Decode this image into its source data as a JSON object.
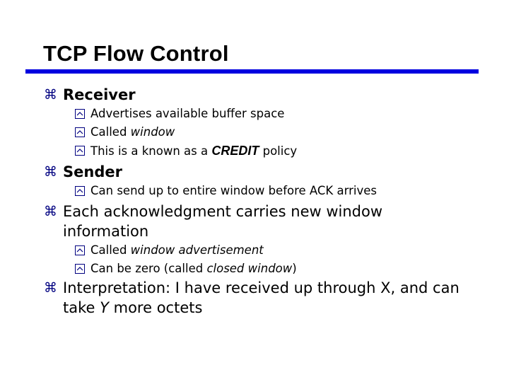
{
  "slide": {
    "title": "TCP Flow Control",
    "bullets": [
      {
        "text": "Receiver",
        "sub": [
          {
            "text": "Advertises available buffer space"
          },
          {
            "pre": "Called ",
            "em": "window"
          },
          {
            "pre": "This is a known as a ",
            "em": "CREDIT",
            "post": " policy"
          }
        ]
      },
      {
        "text": "Sender",
        "sub": [
          {
            "text": "Can send up to entire window before ACK arrives"
          }
        ]
      },
      {
        "line1": "Each acknowledgment carries new window",
        "line2": "information",
        "sub": [
          {
            "pre": "Called ",
            "em": "window advertisement"
          },
          {
            "pre": "Can be zero (called ",
            "em": "closed window",
            "post": ")"
          }
        ]
      },
      {
        "line1": "Interpretation: I have received up through X, and can",
        "line2_pre": "take ",
        "line2_em": "Y",
        "line2_post": " more octets"
      }
    ],
    "bullet_icons": {
      "level1": "⌘",
      "level2": "boxed-caret-icon"
    },
    "colors": {
      "rule": "#0000e0",
      "bullet": "#000080"
    }
  }
}
